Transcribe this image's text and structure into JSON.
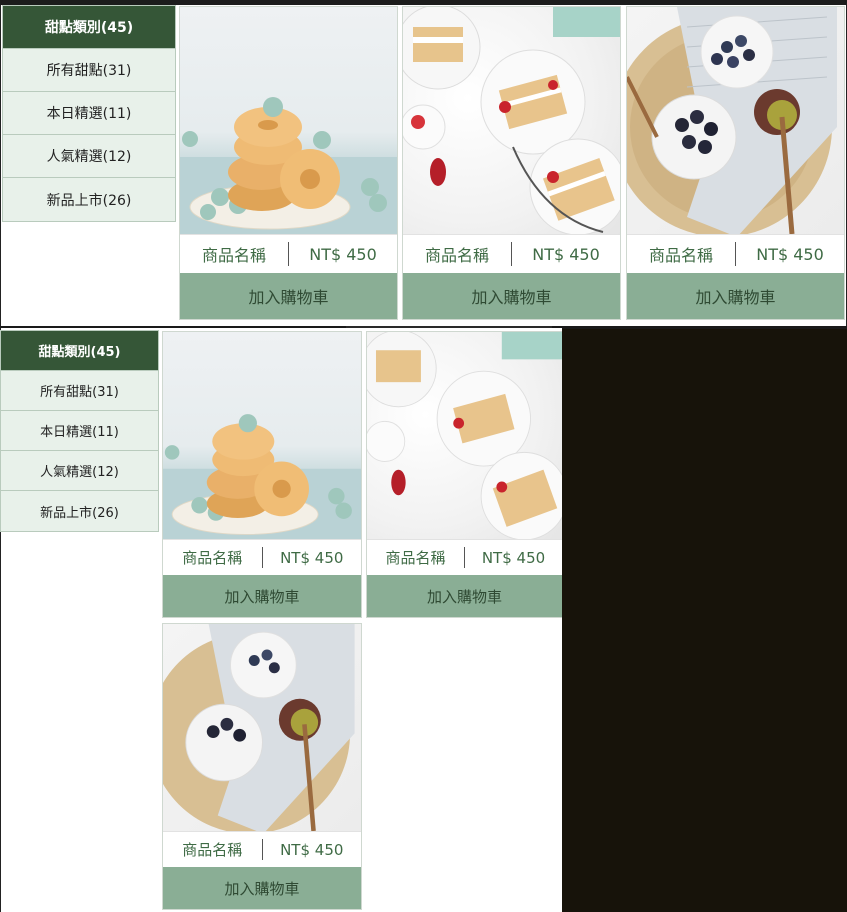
{
  "categories": [
    {
      "label": "甜點類別(45)",
      "active": true
    },
    {
      "label": "所有甜點(31)",
      "active": false
    },
    {
      "label": "本日精選(11)",
      "active": false
    },
    {
      "label": "人氣精選(12)",
      "active": false
    },
    {
      "label": "新品上市(26)",
      "active": false
    }
  ],
  "products": [
    {
      "image": "donut",
      "name": "商品名稱",
      "price": "NT$ 450",
      "cart_label": "加入購物車"
    },
    {
      "image": "cake",
      "name": "商品名稱",
      "price": "NT$ 450",
      "cart_label": "加入購物車"
    },
    {
      "image": "berry",
      "name": "商品名稱",
      "price": "NT$ 450",
      "cart_label": "加入購物車"
    }
  ],
  "colors": {
    "active_category": "#355637",
    "category_bg": "#e8f1ea",
    "cart_button": "#8aae95",
    "text_green": "#3f6b45"
  }
}
